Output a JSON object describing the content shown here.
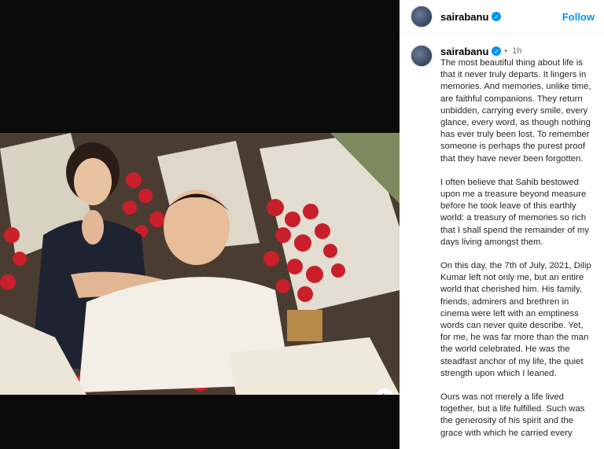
{
  "colors": {
    "accent": "#0095f6",
    "text": "#262626",
    "muted": "#737373"
  },
  "post": {
    "username": "sairabanu",
    "follow_label": "Follow",
    "time": "1h",
    "icons": {
      "verified": "verified-badge-icon",
      "next": "chevron-right-icon"
    },
    "paragraphs": [
      "The most beautiful thing about life is that it never truly departs. It lingers in memories. And memories, unlike time, are faithful companions. They return unbidden, carrying every smile, every glance, every word, as though nothing has ever truly been lost. To remember someone is perhaps the purest proof that they have never been forgotten.",
      "I often believe that Sahib bestowed upon me a treasure beyond measure before he took leave of this earthly world: a treasury of memories so rich that I shall spend the remainder of my days living amongst them.",
      "On this day, the 7th of July, 2021, Dilip Kumar left not only me, but an entire world that cherished him. His family, friends, admirers and brethren in cinema were left with an emptiness words can never quite describe. Yet, for me, he was far more than the man the world celebrated. He was the steadfast anchor of my life, the quiet strength upon which I leaned.",
      "Ours was not merely a life lived together, but a life fulfilled. Such was the generosity of his spirit and the grace with which he carried every"
    ]
  }
}
